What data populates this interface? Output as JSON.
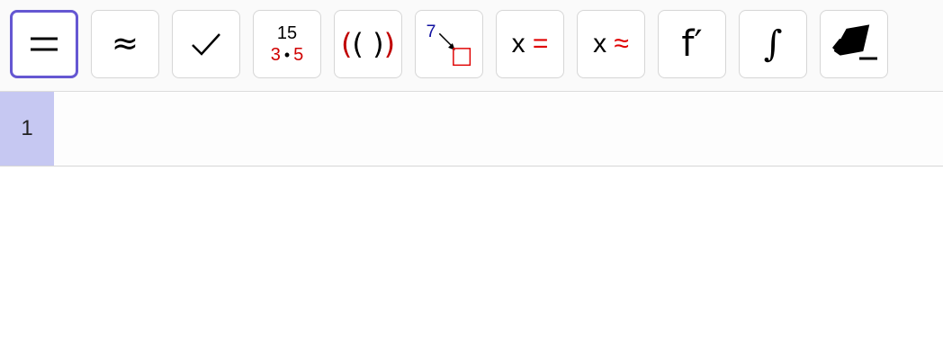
{
  "toolbar": {
    "tools": [
      {
        "name": "evaluate",
        "glyph": "="
      },
      {
        "name": "numeric",
        "glyph": "≈"
      },
      {
        "name": "keep-input",
        "glyph": "✓"
      },
      {
        "name": "factor",
        "top": "15",
        "left": "3",
        "dot": "•",
        "right": "5"
      },
      {
        "name": "expand",
        "open_outer": "(",
        "open_inner": "(",
        "close_inner": ")",
        "close_outer": ")"
      },
      {
        "name": "substitute",
        "label": "7"
      },
      {
        "name": "solve",
        "x": "x",
        "op": "="
      },
      {
        "name": "nsolve",
        "x": "x",
        "op": "≈"
      },
      {
        "name": "derivative",
        "glyph": "f′"
      },
      {
        "name": "integral",
        "glyph": "∫"
      },
      {
        "name": "delete",
        "icon": "eraser-icon"
      }
    ],
    "selected_index": 0
  },
  "rows": [
    {
      "number": "1",
      "input": ""
    }
  ],
  "colors": {
    "selected_border": "#6557d2",
    "row_number_bg": "#c6c8f2",
    "accent_red": "#e00000",
    "accent_blue": "#1010a0"
  }
}
